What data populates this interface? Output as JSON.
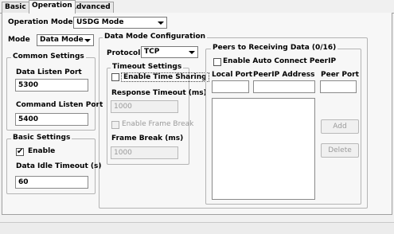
{
  "tabs": [
    "Basic",
    "Operation",
    "Advanced"
  ],
  "operation_mode": {
    "label": "Operation Mode",
    "value": "USDG Mode"
  },
  "mode": {
    "label": "Mode",
    "value": "Data Mode"
  },
  "common_settings": {
    "title": "Common Settings",
    "data_listen_port_label": "Data Listen Port",
    "data_listen_port": "5300",
    "command_listen_port_label": "Command Listen Port",
    "command_listen_port": "5400"
  },
  "basic_settings": {
    "title": "Basic Settings",
    "enable_label": "Enable",
    "enable_checked": true,
    "idle_timeout_label": "Data Idle Timeout (s)",
    "idle_timeout": "60"
  },
  "data_mode_config": {
    "title": "Data Mode Configuration",
    "protocol_label": "Protocol",
    "protocol": "TCP"
  },
  "timeout_settings": {
    "title": "Timeout Settings",
    "time_sharing_label": "Enable Time Sharing",
    "time_sharing_checked": false,
    "response_timeout_label": "Response Timeout (ms)",
    "response_timeout": "1000",
    "frame_break_enable_label": "Enable Frame Break",
    "frame_break_label": "Frame Break (ms)",
    "frame_break": "1000"
  },
  "peers": {
    "title": "Peers to Receiving Data (0/16)",
    "auto_connect_label": "Enable Auto Connect PeerIP",
    "auto_connect_checked": false,
    "local_port_label": "Local Port",
    "peer_ip_label": "PeerIP Address",
    "peer_port_label": "Peer Port",
    "local_port": "",
    "peer_ip": "",
    "peer_port": "",
    "add_label": "Add",
    "delete_label": "Delete"
  }
}
